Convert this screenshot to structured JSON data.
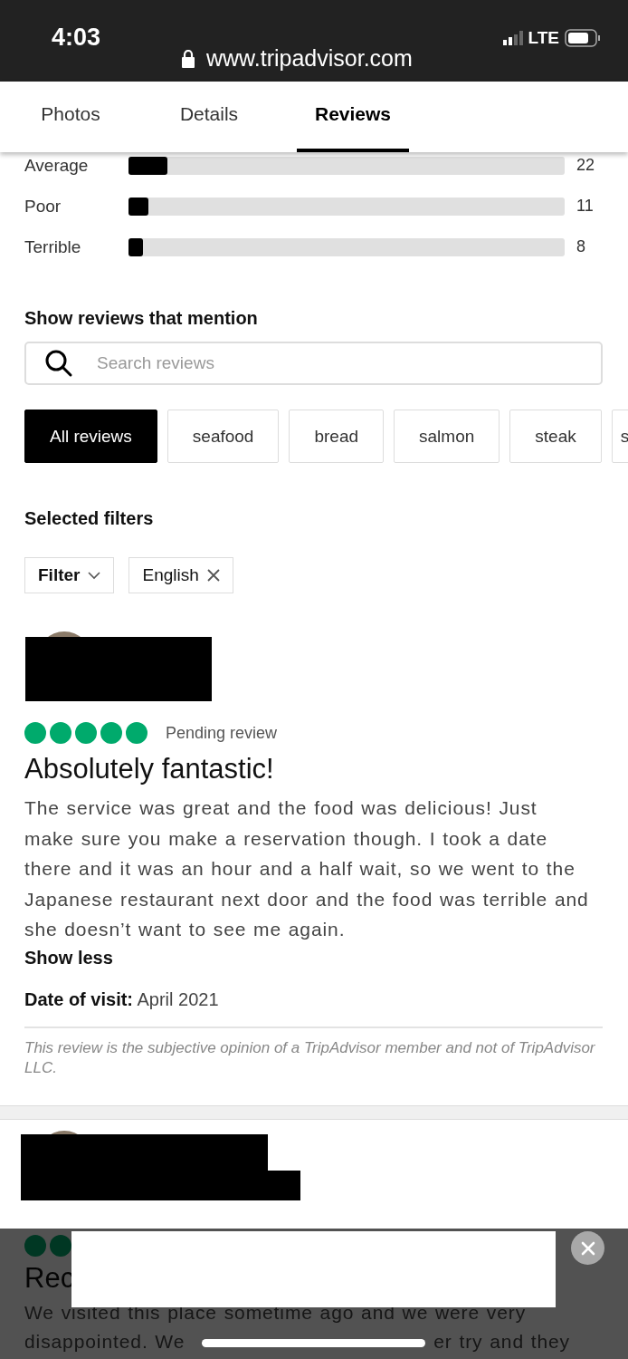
{
  "status_bar": {
    "time": "4:03",
    "carrier": "LTE",
    "url": "www.tripadvisor.com"
  },
  "tabs": [
    {
      "label": "Photos",
      "selected": false
    },
    {
      "label": "Details",
      "selected": false
    },
    {
      "label": "Reviews",
      "selected": true
    }
  ],
  "ratings": [
    {
      "label": "Average",
      "level": 0.09,
      "count": "22"
    },
    {
      "label": "Poor",
      "level": 0.045,
      "count": "11"
    },
    {
      "label": "Terrible",
      "level": 0.033,
      "count": "8"
    }
  ],
  "mention": {
    "heading": "Show reviews that mention",
    "placeholder": "Search reviews"
  },
  "chips": [
    {
      "label": "All reviews",
      "selected": true
    },
    {
      "label": "seafood",
      "selected": false
    },
    {
      "label": "bread",
      "selected": false
    },
    {
      "label": "salmon",
      "selected": false
    },
    {
      "label": "steak",
      "selected": false
    },
    {
      "label": "s",
      "selected": false
    }
  ],
  "filters": {
    "heading": "Selected filters",
    "buttons": [
      {
        "label": "Filter",
        "kind": "dropdown"
      },
      {
        "label": "English",
        "kind": "removable"
      }
    ]
  },
  "reviews": [
    {
      "stars": 5,
      "status": "Pending review",
      "title": "Absolutely fantastic!",
      "body": "The service was great and the food was delicious! Just make sure you make a reservation though. I took a date there and it was an hour and a half wait, so we went to the Japanese restaurant next door and the food was terrible and she doesn’t want to see me again.",
      "toggle": "Show less",
      "date_label": "Date of visit:",
      "date": "April 2021",
      "disclaimer": "This review is the subjective opinion of a TripAdvisor member and not of TripAdvisor LLC."
    },
    {
      "kind": "covered",
      "title": "Rec",
      "line_1": "We visited this place sometime ago and we were very",
      "line_2_parts": [
        "disappointed. We",
        "er try and they"
      ]
    }
  ]
}
